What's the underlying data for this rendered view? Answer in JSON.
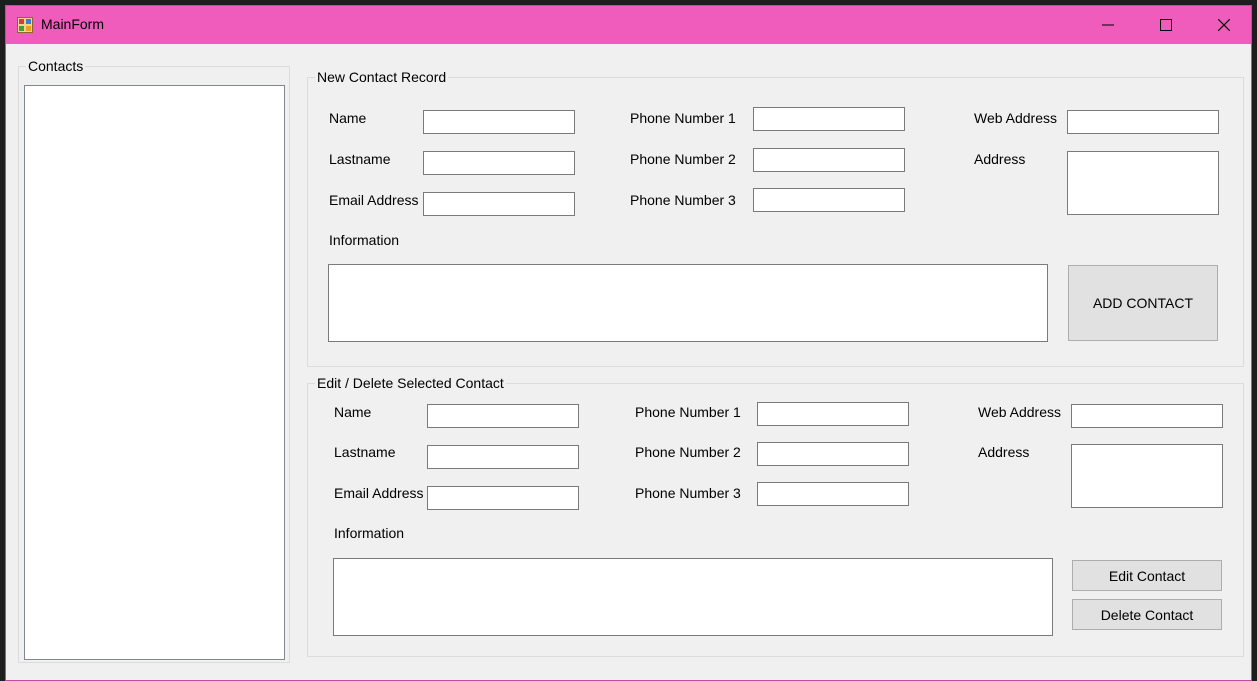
{
  "window": {
    "title": "MainForm"
  },
  "contacts_group": {
    "title": "Contacts",
    "items": []
  },
  "new_contact": {
    "title": "New Contact Record",
    "labels": {
      "name": "Name",
      "lastname": "Lastname",
      "email": "Email Address",
      "phone1": "Phone Number 1",
      "phone2": "Phone Number 2",
      "phone3": "Phone Number 3",
      "web": "Web Address",
      "address": "Address",
      "information": "Information"
    },
    "values": {
      "name": "",
      "lastname": "",
      "email": "",
      "phone1": "",
      "phone2": "",
      "phone3": "",
      "web": "",
      "address": "",
      "information": ""
    },
    "add_button": "ADD CONTACT"
  },
  "edit_contact": {
    "title": "Edit / Delete Selected Contact",
    "labels": {
      "name": "Name",
      "lastname": "Lastname",
      "email": "Email Address",
      "phone1": "Phone Number 1",
      "phone2": "Phone Number 2",
      "phone3": "Phone Number 3",
      "web": "Web Address",
      "address": "Address",
      "information": "Information"
    },
    "values": {
      "name": "",
      "lastname": "",
      "email": "",
      "phone1": "",
      "phone2": "",
      "phone3": "",
      "web": "",
      "address": "",
      "information": ""
    },
    "edit_button": "Edit Contact",
    "delete_button": "Delete Contact"
  },
  "colors": {
    "titlebar": "#f05cbc",
    "form_background": "#f0f0f0",
    "button_face": "#e1e1e1"
  }
}
